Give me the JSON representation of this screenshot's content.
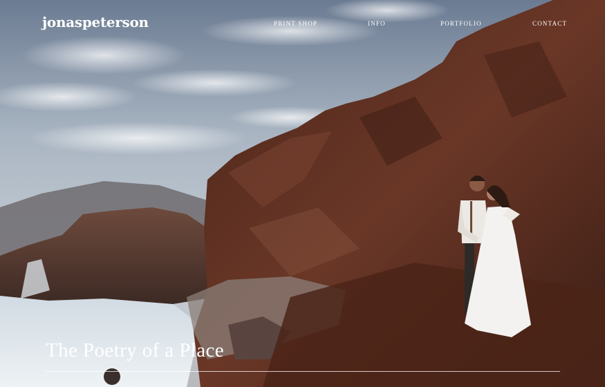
{
  "brand": {
    "logo_text": "jonaspeterson"
  },
  "nav": {
    "items": [
      {
        "label": "PRINT SHOP"
      },
      {
        "label": "INFO"
      },
      {
        "label": "PORTFOLIO"
      },
      {
        "label": "CONTACT"
      }
    ]
  },
  "hero": {
    "title": "The Poetry of a Place",
    "image_subject": "couple embracing on volcanic coastal cliffs by the sea"
  },
  "colors": {
    "sky_top": "#6f7f94",
    "sky_bottom": "#c9d1d8",
    "rock": "#5a2f22",
    "sea": "#dfe7ee",
    "text": "#ffffff"
  }
}
